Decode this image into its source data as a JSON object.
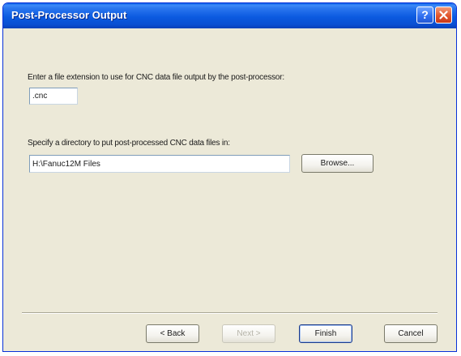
{
  "window": {
    "title": "Post-Processor Output"
  },
  "titlebar": {
    "help_label": "?",
    "close_icon": "close-icon"
  },
  "extension": {
    "label": "Enter a file extension to use for CNC data file output by the post-processor:",
    "value": ".cnc"
  },
  "directory": {
    "label": "Specify a directory to put post-processed CNC data files in:",
    "value": "H:\\Fanuc12M Files",
    "browse_label": "Browse..."
  },
  "footer": {
    "back_label": "< Back",
    "next_label": "Next >",
    "finish_label": "Finish",
    "cancel_label": "Cancel"
  },
  "colors": {
    "titlebar": "#0a5fe8",
    "dialog_bg": "#ece9d8",
    "close_button": "#e2552c"
  }
}
